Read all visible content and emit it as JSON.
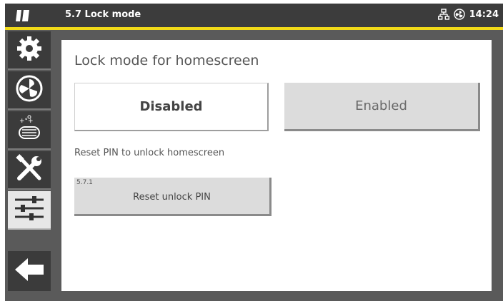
{
  "header": {
    "title": "5.7 Lock mode",
    "time": "14:24",
    "icons": [
      "app-logo-icon",
      "network-icon",
      "fan-status-icon"
    ]
  },
  "sidebar": {
    "items": [
      {
        "name": "settings",
        "icon": "gear-icon"
      },
      {
        "name": "fan",
        "icon": "fan-icon"
      },
      {
        "name": "filter",
        "icon": "filter-icon"
      },
      {
        "name": "service",
        "icon": "tools-icon"
      },
      {
        "name": "adjustments",
        "icon": "sliders-icon",
        "active": true
      },
      {
        "name": "back",
        "icon": "arrow-left-icon"
      }
    ]
  },
  "main": {
    "heading": "Lock mode for homescreen",
    "options": {
      "disabled_label": "Disabled",
      "enabled_label": "Enabled",
      "selected": "Disabled"
    },
    "reset_label": "Reset PIN to unlock homescreen",
    "reset_button": {
      "number": "5.7.1",
      "label": "Reset unlock PIN"
    }
  },
  "colors": {
    "accent": "#f1da18",
    "topbar": "#3c3c3c",
    "sidebar": "#3b3b3b",
    "button_gray": "#dcdcdc"
  }
}
